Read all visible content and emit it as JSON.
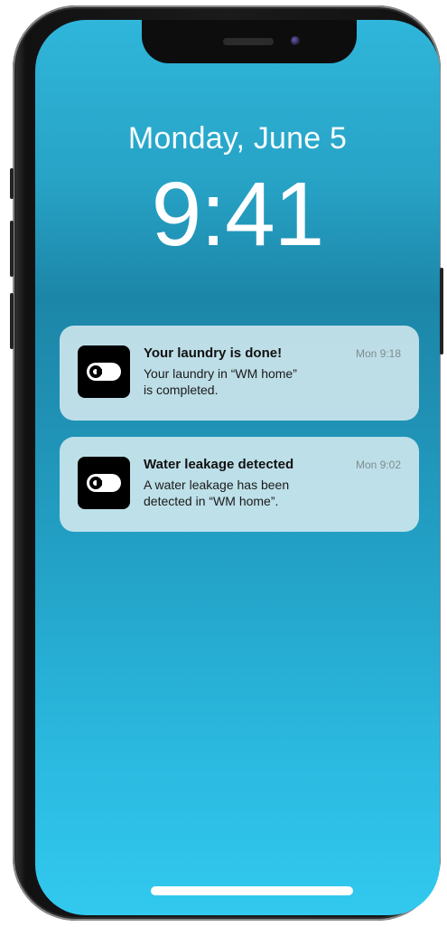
{
  "lockscreen": {
    "date": "Monday, June 5",
    "time": "9:41"
  },
  "notifications": [
    {
      "title": "Your laundry is done!",
      "timestamp": "Mon 9:18",
      "body_line1": "Your laundry in “WM home”",
      "body_line2": "is completed.",
      "icon": "toggle-switch-icon"
    },
    {
      "title": "Water leakage detected",
      "timestamp": "Mon 9:02",
      "body_line1": "A water leakage has been",
      "body_line2": "detected in “WM home”.",
      "icon": "toggle-switch-icon"
    }
  ],
  "colors": {
    "wallpaper_top": "#2fb6da",
    "wallpaper_mid": "#1c86a8",
    "wallpaper_bottom": "#32c9ef",
    "notification_bg": "#d7ebf0",
    "app_icon_bg": "#000000"
  }
}
